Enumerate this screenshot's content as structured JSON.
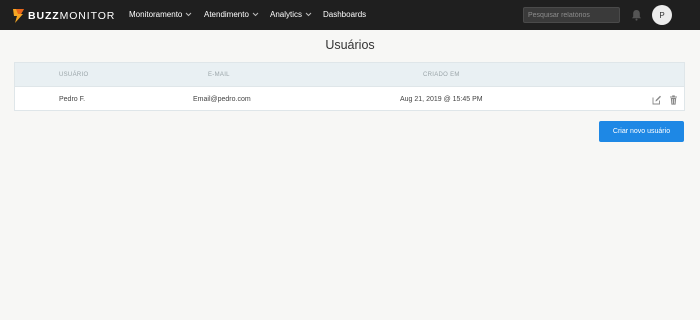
{
  "brand": {
    "name_bold": "BUZZ",
    "name_light": "MONITOR",
    "mark_color": "#f5a623"
  },
  "nav": {
    "items": [
      {
        "label": "Monitoramento",
        "has_dropdown": true
      },
      {
        "label": "Atendimento",
        "has_dropdown": true
      },
      {
        "label": "Analytics",
        "has_dropdown": true
      },
      {
        "label": "Dashboards",
        "has_dropdown": false
      }
    ]
  },
  "header": {
    "search_placeholder": "Pesquisar relatórios",
    "avatar_initial": "P"
  },
  "page": {
    "title": "Usuários"
  },
  "table": {
    "columns": [
      "USUÁRIO",
      "E-MAIL",
      "CRIADO EM"
    ],
    "rows": [
      {
        "user": "Pedro F.",
        "email": "Email@pedro.com",
        "created": "Aug 21, 2019 @ 15:45 PM"
      }
    ]
  },
  "actions": {
    "create_user_label": "Criar novo usuário"
  },
  "colors": {
    "topbar": "#1f1f1f",
    "accent": "#1e88e5",
    "table_header": "#e9f0f3",
    "background": "#f7f7f5"
  }
}
